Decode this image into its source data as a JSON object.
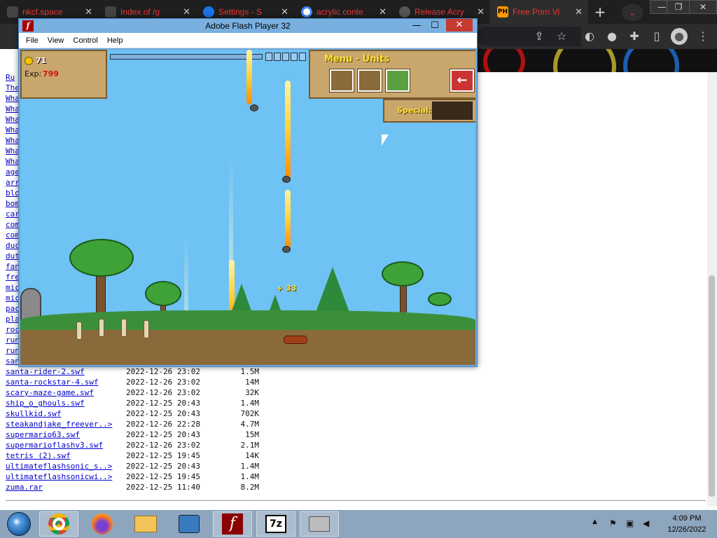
{
  "browser": {
    "tabs": [
      {
        "title": "nkcf.space",
        "close": "✕"
      },
      {
        "title": "Index of /g",
        "close": "✕"
      },
      {
        "title": "Settings - S",
        "close": "✕"
      },
      {
        "title": "acrylic conte",
        "close": "✕"
      },
      {
        "title": "Release Acry",
        "close": "✕"
      },
      {
        "title": "Free Porn Vi",
        "close": "✕",
        "favicon_text": "PH"
      }
    ],
    "new_tab": "+",
    "tab_search": "⌄",
    "window_controls": [
      "—",
      "❐",
      "✕"
    ],
    "toolbar_icons": [
      "share-icon",
      "star-icon",
      "extension-icon",
      "profile-icon",
      "puzzle-icon",
      "sidepanel-icon",
      "account-icon",
      "menu-icon"
    ]
  },
  "flash_window": {
    "title": "Adobe Flash Player 32",
    "icon": "f",
    "minimize": "—",
    "maximize": "☐",
    "close": "✕",
    "menu": [
      "File",
      "View",
      "Control",
      "Help"
    ]
  },
  "game": {
    "gold": "71",
    "exp_label": "Exp:",
    "exp_value": "799",
    "menu_title": "Menu - Units",
    "special_label": "Special:",
    "bonus_text": "+ 33",
    "back_arrow": "←"
  },
  "listing": {
    "partial_rows": [
      "Ru",
      "The",
      "Wha",
      "Wha",
      "Wha",
      "Wha",
      "Wha",
      "Wha",
      "Wha",
      "age",
      "arr",
      "blo",
      "bom",
      "car",
      "com",
      "com",
      "duc",
      "dut",
      "fan",
      "fre",
      "mic",
      "mic",
      "pac",
      "pla",
      "roc",
      "run",
      "run",
      "san"
    ],
    "rows": [
      {
        "name": "santa-rider-2.swf",
        "date": "2022-12-26 23:02",
        "size": "1.5M"
      },
      {
        "name": "santa-rockstar-4.swf",
        "date": "2022-12-26 23:02",
        "size": "14M"
      },
      {
        "name": "scary-maze-game.swf",
        "date": "2022-12-26 23:02",
        "size": "32K"
      },
      {
        "name": "ship_o_ghouls.swf",
        "date": "2022-12-25 20:43",
        "size": "1.4M"
      },
      {
        "name": "skullkid.swf",
        "date": "2022-12-25 20:43",
        "size": "702K"
      },
      {
        "name": "steakandjake_freever..>",
        "date": "2022-12-26 22:28",
        "size": "4.7M"
      },
      {
        "name": "supermario63.swf",
        "date": "2022-12-25 20:43",
        "size": "15M"
      },
      {
        "name": "supermarioflashv3.swf",
        "date": "2022-12-26 23:02",
        "size": "2.1M"
      },
      {
        "name": "tetris (2).swf",
        "date": "2022-12-25 19:45",
        "size": "14K"
      },
      {
        "name": "ultimateflashsonic_s..>",
        "date": "2022-12-25 20:43",
        "size": "1.4M"
      },
      {
        "name": "ultimateflashsonicwi..>",
        "date": "2022-12-25 19:45",
        "size": "1.4M"
      },
      {
        "name": "zuma.rar",
        "date": "2022-12-25 11:40",
        "size": "8.2M"
      }
    ]
  },
  "taskbar": {
    "apps": [
      "start-orb-icon",
      "chrome-icon",
      "firefox-icon",
      "explorer-icon",
      "network-icon",
      "flash-icon",
      "7zip-icon",
      "drive-icon"
    ],
    "seven_zip_label": "7z",
    "time": "4:09 PM",
    "date": "12/26/2022",
    "tray_arrow": "▲"
  },
  "colors": {
    "tab_text": "#e33333",
    "link": "#0000cc",
    "flash_frame": "#6fa8dc",
    "close_red": "#c63a2f",
    "sky": "#6ec2f4",
    "ground": "#8a6a3a",
    "taskbar": "#8ea6bd"
  }
}
